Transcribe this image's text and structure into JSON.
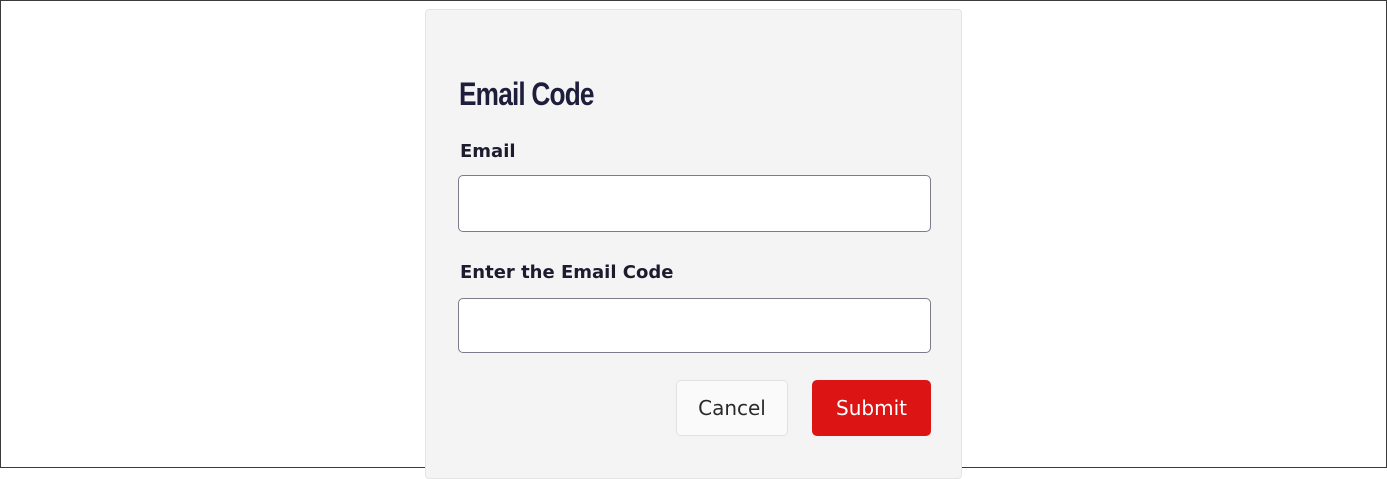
{
  "form": {
    "title": "Email Code",
    "email_label": "Email",
    "email_value": "",
    "email_placeholder": "",
    "code_label": "Enter the Email Code",
    "code_value": "",
    "code_placeholder": ""
  },
  "actions": {
    "cancel_label": "Cancel",
    "submit_label": "Submit"
  },
  "colors": {
    "submit_background": "#dc1414",
    "title_text": "#1e1e3c",
    "card_background": "#f4f4f4"
  }
}
